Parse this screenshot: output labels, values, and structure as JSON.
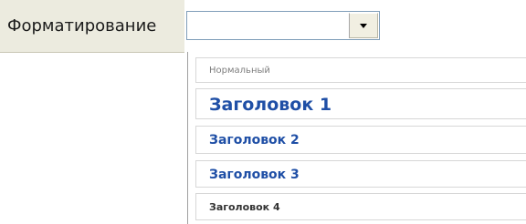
{
  "toolbar": {
    "format_label": "Форматирование",
    "select_value": ""
  },
  "dropdown": {
    "options": [
      {
        "label": "Нормальный"
      },
      {
        "label": "Заголовок 1"
      },
      {
        "label": "Заголовок 2"
      },
      {
        "label": "Заголовок 3"
      },
      {
        "label": "Заголовок 4"
      }
    ]
  },
  "icons": {
    "select_arrow": "chevron-down-icon"
  },
  "colors": {
    "toolbar_bg": "#ecebdf",
    "heading_blue": "#1f4fa6",
    "normal_gray": "#7e7e7e"
  }
}
